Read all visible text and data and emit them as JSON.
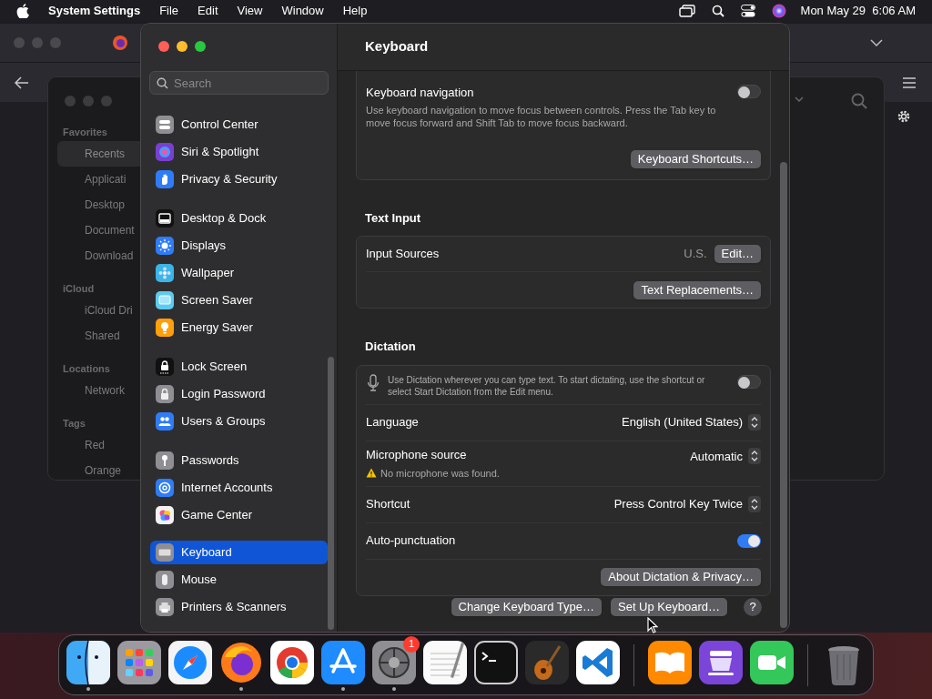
{
  "menubar": {
    "app": "System Settings",
    "menus": [
      "File",
      "Edit",
      "View",
      "Window",
      "Help"
    ],
    "clock": "Mon May 29  6:06 AM"
  },
  "finder": {
    "sections": [
      {
        "title": "Favorites",
        "items": [
          {
            "label": "Recents",
            "selected": true
          },
          {
            "label": "Applicati",
            "selected": false
          },
          {
            "label": "Desktop",
            "selected": false
          },
          {
            "label": "Document",
            "selected": false
          },
          {
            "label": "Download",
            "selected": false
          }
        ]
      },
      {
        "title": "iCloud",
        "items": [
          {
            "label": "iCloud Dri",
            "selected": false
          },
          {
            "label": "Shared",
            "selected": false
          }
        ]
      },
      {
        "title": "Locations",
        "items": [
          {
            "label": "Network",
            "selected": false
          }
        ]
      },
      {
        "title": "Tags",
        "items": [
          {
            "label": "Red",
            "selected": false
          },
          {
            "label": "Orange",
            "selected": false
          }
        ]
      }
    ]
  },
  "settings": {
    "search": {
      "placeholder": "Search"
    },
    "sidebar": [
      [
        {
          "label": "Control Center",
          "selected": false
        },
        {
          "label": "Siri & Spotlight",
          "selected": false
        },
        {
          "label": "Privacy & Security",
          "selected": false
        }
      ],
      [
        {
          "label": "Desktop & Dock",
          "selected": false
        },
        {
          "label": "Displays",
          "selected": false
        },
        {
          "label": "Wallpaper",
          "selected": false
        },
        {
          "label": "Screen Saver",
          "selected": false
        },
        {
          "label": "Energy Saver",
          "selected": false
        }
      ],
      [
        {
          "label": "Lock Screen",
          "selected": false
        },
        {
          "label": "Login Password",
          "selected": false
        },
        {
          "label": "Users & Groups",
          "selected": false
        }
      ],
      [
        {
          "label": "Passwords",
          "selected": false
        },
        {
          "label": "Internet Accounts",
          "selected": false
        },
        {
          "label": "Game Center",
          "selected": false
        }
      ],
      [
        {
          "label": "Keyboard",
          "selected": true
        },
        {
          "label": "Mouse",
          "selected": false
        },
        {
          "label": "Printers & Scanners",
          "selected": false
        }
      ]
    ],
    "title": "Keyboard",
    "sections": [
      {
        "rows": [
          {
            "kind": "toggle",
            "label": "Keyboard navigation",
            "description": "Use keyboard navigation to move focus between controls. Press the Tab key to move focus forward and Shift Tab to move focus backward.",
            "on": false
          },
          {
            "kind": "button",
            "button": "Keyboard Shortcuts…"
          }
        ]
      },
      {
        "title": "Text Input",
        "rows": [
          {
            "kind": "value_button",
            "label": "Input Sources",
            "value": "U.S.",
            "button": "Edit…"
          },
          {
            "kind": "button",
            "button": "Text Replacements…"
          }
        ]
      },
      {
        "title": "Dictation",
        "rows": [
          {
            "kind": "info_toggle",
            "description": "Use Dictation wherever you can type text. To start dictating, use the shortcut or select Start Dictation from the Edit menu.",
            "on": false
          },
          {
            "kind": "popup",
            "label": "Language",
            "value": "English (United States)"
          },
          {
            "kind": "popup",
            "label": "Microphone source",
            "value": "Automatic",
            "warning": "No microphone was found."
          },
          {
            "kind": "popup",
            "label": "Shortcut",
            "value": "Press Control Key Twice"
          },
          {
            "kind": "toggle",
            "label": "Auto-punctuation",
            "on": true
          },
          {
            "kind": "button",
            "button": "About Dictation & Privacy…"
          }
        ]
      }
    ],
    "footer_buttons": [
      "Change Keyboard Type…",
      "Set Up Keyboard…"
    ],
    "help": "?"
  },
  "dock": {
    "apps": [
      {
        "running": true
      },
      {
        "running": false
      },
      {
        "running": false
      },
      {
        "running": true
      },
      {
        "running": false
      },
      {
        "running": true
      },
      {
        "running": true,
        "badge": "1"
      },
      {
        "running": false
      },
      {
        "running": false
      },
      {
        "running": false
      },
      {
        "running": false
      }
    ],
    "extras": [
      {
        "running": false
      },
      {
        "running": false
      },
      {
        "running": false
      }
    ]
  }
}
